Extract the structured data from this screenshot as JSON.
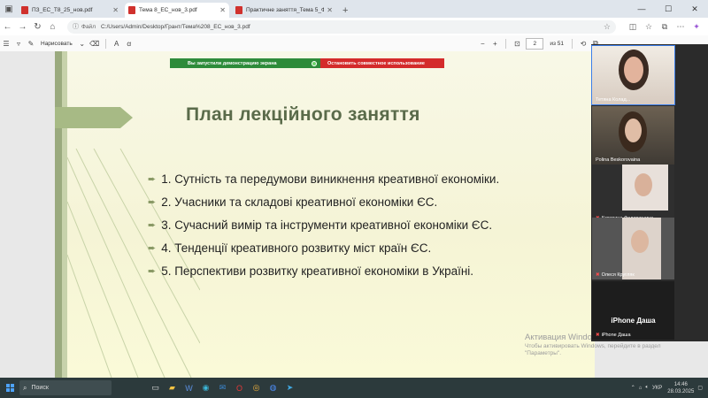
{
  "tabs": [
    {
      "title": "ПЗ_ЕС_Т8_25_нов.pdf",
      "active": false
    },
    {
      "title": "Тема 8_ЕС_нов_3.pdf",
      "active": true
    },
    {
      "title": "Практичне заняття_Тема 5_Фінан",
      "active": false
    }
  ],
  "address": {
    "label": "Файл",
    "url": "C:/Users/Admin/Desktop/Грант/Тема%208_ЕС_нов_3.pdf"
  },
  "pdf_toolbar": {
    "draw_label": "Нарисовать",
    "page_current": "2",
    "page_total": "из 51"
  },
  "notification": {
    "demo": "Вы запустили демонстрацию экрана",
    "stop": "Остановить совместное использование"
  },
  "slide": {
    "title": "План лекційного заняття",
    "items": [
      "1. Сутність та передумови виникнення креативної економіки.",
      "2. Учасники та складові креативної економіки ЄС.",
      "3. Сучасний вимір та інструменти креативної економіки ЄС.",
      "4. Тенденції креативного розвитку міст країн ЄС.",
      "5. Перспективи розвитку креативної економіки в Україні."
    ]
  },
  "watermark": {
    "line1": "Активация Windows",
    "line2": "Чтобы активировать Windows, перейдите в раздел",
    "line3": "\"Параметры\"."
  },
  "participants": [
    {
      "name": "Тетяна Колад..."
    },
    {
      "name": "Polina Beskorovaina"
    },
    {
      "name": "Катерина Федоришина"
    },
    {
      "name": "Олеся Кругляк"
    },
    {
      "name": "iPhone Даша",
      "big_label": "iPhone Даша"
    }
  ],
  "taskbar": {
    "search": "Поиск",
    "lang": "УКР",
    "time": "14:46",
    "date": "28.03.2025"
  },
  "colors": {
    "title_green": "#5a6b4a",
    "accent_green": "#a7ba85",
    "notif_green": "#2e8b3a",
    "notif_red": "#d42b2b",
    "taskbar": "#2c3a3c"
  }
}
